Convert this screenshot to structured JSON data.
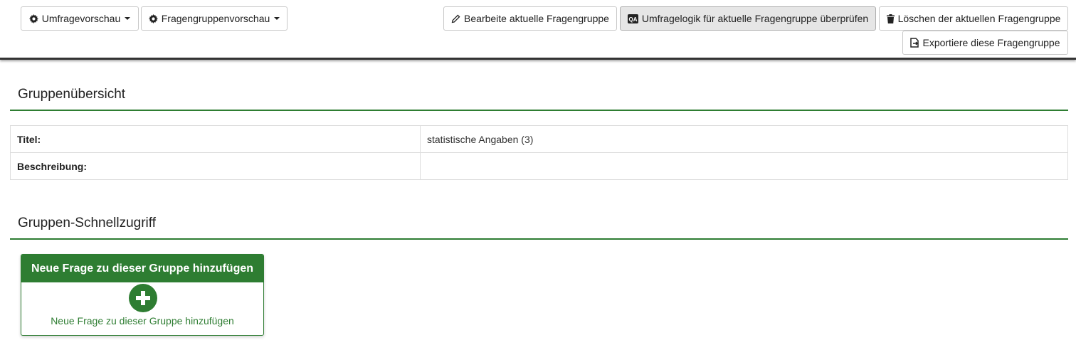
{
  "toolbar": {
    "survey_preview": "Umfragevorschau",
    "group_preview": "Fragengruppenvorschau",
    "edit_group": "Bearbeite aktuelle Fragengruppe",
    "check_logic": "Umfragelogik für aktuelle Fragengruppe überprüfen",
    "delete_group": "Löschen der aktuellen Fragengruppe",
    "export_group": "Exportiere diese Fragengruppe",
    "icons": [
      "gear-icon",
      "pencil-icon",
      "qa-icon",
      "trash-icon",
      "export-icon",
      "caret-down-icon"
    ]
  },
  "overview": {
    "heading": "Gruppenübersicht",
    "rows": [
      {
        "label": "Titel:",
        "value": "statistische Angaben (3)"
      },
      {
        "label": "Beschreibung:",
        "value": ""
      }
    ]
  },
  "quick_access": {
    "heading": "Gruppen-Schnellzugriff",
    "panel_title": "Neue Frage zu dieser Gruppe hinzufügen",
    "panel_text": "Neue Frage zu dieser Gruppe hinzufügen",
    "icon": "plus-circle-icon"
  },
  "colors": {
    "accent": "#2e7d32",
    "border": "#c8c8c8",
    "active_button_bg": "#e6e6e6"
  }
}
